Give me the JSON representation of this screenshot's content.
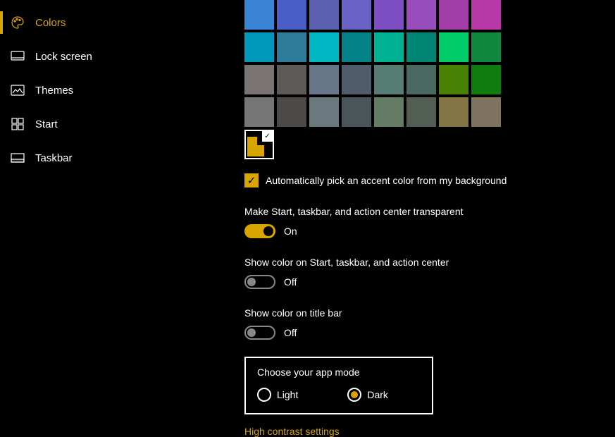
{
  "sidebar": {
    "items": [
      {
        "label": "Colors",
        "icon": "palette-icon",
        "active": true
      },
      {
        "label": "Lock screen",
        "icon": "lock-screen-icon",
        "active": false
      },
      {
        "label": "Themes",
        "icon": "themes-icon",
        "active": false
      },
      {
        "label": "Start",
        "icon": "start-icon",
        "active": false
      },
      {
        "label": "Taskbar",
        "icon": "taskbar-icon",
        "active": false
      }
    ]
  },
  "content": {
    "colorGrid": [
      [
        "#3a84d6",
        "#4a5ec7",
        "#5a5fb0",
        "#6a62c5",
        "#7d4fc2",
        "#9a4dbd",
        "#a33da8",
        "#b838a8"
      ],
      [
        "#0099bc",
        "#2d7d9a",
        "#00b7c3",
        "#038387",
        "#00b294",
        "#018574",
        "#00cc6a",
        "#10893e"
      ],
      [
        "#7a7574",
        "#5d5a58",
        "#68768a",
        "#515c6b",
        "#567c73",
        "#486860",
        "#498205",
        "#107c10"
      ],
      [
        "#767676",
        "#4c4a48",
        "#69797e",
        "#4a5459",
        "#647c64",
        "#525e54",
        "#847545",
        "#7e735f"
      ]
    ],
    "selectedAccent": "#d9a500",
    "autoPick": {
      "checked": true,
      "label": "Automatically pick an accent color from my background"
    },
    "transparency": {
      "label": "Make Start, taskbar, and action center transparent",
      "on": true,
      "stateText": "On"
    },
    "showColorStart": {
      "label": "Show color on Start, taskbar, and action center",
      "on": false,
      "stateText": "Off"
    },
    "showColorTitle": {
      "label": "Show color on title bar",
      "on": false,
      "stateText": "Off"
    },
    "appMode": {
      "title": "Choose your app mode",
      "options": {
        "light": "Light",
        "dark": "Dark"
      },
      "selected": "dark"
    },
    "highContrastLink": "High contrast settings"
  }
}
